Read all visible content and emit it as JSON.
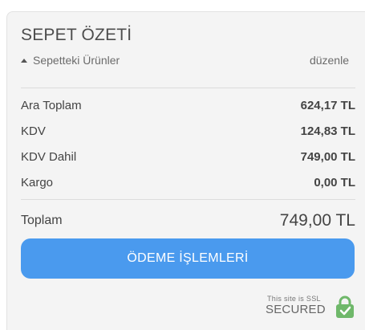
{
  "summary": {
    "title": "SEPET ÖZETİ",
    "products_label": "Sepetteki Ürünler",
    "edit_label": "düzenle"
  },
  "lines": [
    {
      "label": "Ara Toplam",
      "value": "624,17 TL"
    },
    {
      "label": "KDV",
      "value": "124,83 TL"
    },
    {
      "label": "KDV Dahil",
      "value": "749,00 TL"
    },
    {
      "label": "Kargo",
      "value": "0,00 TL"
    }
  ],
  "total": {
    "label": "Toplam",
    "value": "749,00 TL"
  },
  "checkout": {
    "label": "ÖDEME İŞLEMLERİ",
    "color": "#4a9aee"
  },
  "ssl": {
    "line1": "This site is SSL",
    "line2": "SECURED",
    "lock_color": "#6fb86a"
  }
}
